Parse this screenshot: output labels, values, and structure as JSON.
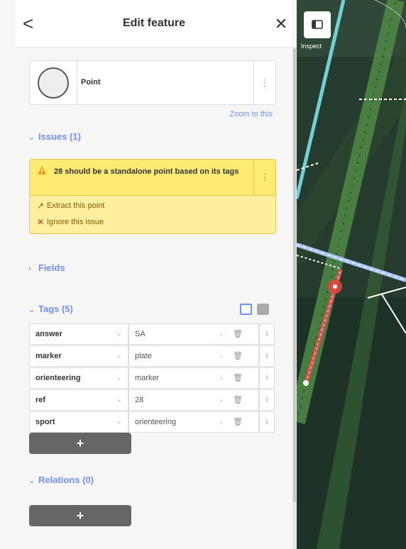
{
  "header": {
    "title": "Edit feature",
    "back_glyph": "<",
    "close_glyph": "✕"
  },
  "preset": {
    "name": "Point",
    "icon": "point-circle-icon",
    "more_glyph": "⋮"
  },
  "zoom_link": "Zoom to this",
  "issues": {
    "header": "Issues (1)",
    "items": [
      {
        "message": "28 should be a standalone point based on its tags",
        "fixes": [
          {
            "label": "Extract this point",
            "icon": "extract-icon"
          },
          {
            "label": "Ignore this issue",
            "icon": "close-icon"
          }
        ]
      }
    ]
  },
  "fields": {
    "header": "Fields"
  },
  "tags": {
    "header": "Tags (5)",
    "rows": [
      {
        "key": "answer",
        "value": "SA"
      },
      {
        "key": "marker",
        "value": "plate"
      },
      {
        "key": "orienteering",
        "value": "marker"
      },
      {
        "key": "ref",
        "value": "28"
      },
      {
        "key": "sport",
        "value": "orienteering"
      }
    ],
    "add_label": "+"
  },
  "relations": {
    "header": "Relations (0)",
    "add_label": "+"
  },
  "map": {
    "inspect_label": "Inspect"
  },
  "colors": {
    "accent": "#7092ff",
    "warning_bg": "#ffea74",
    "warning_border": "#e6c84a",
    "button_bg": "#666666",
    "selected_line": "#d9534f"
  }
}
